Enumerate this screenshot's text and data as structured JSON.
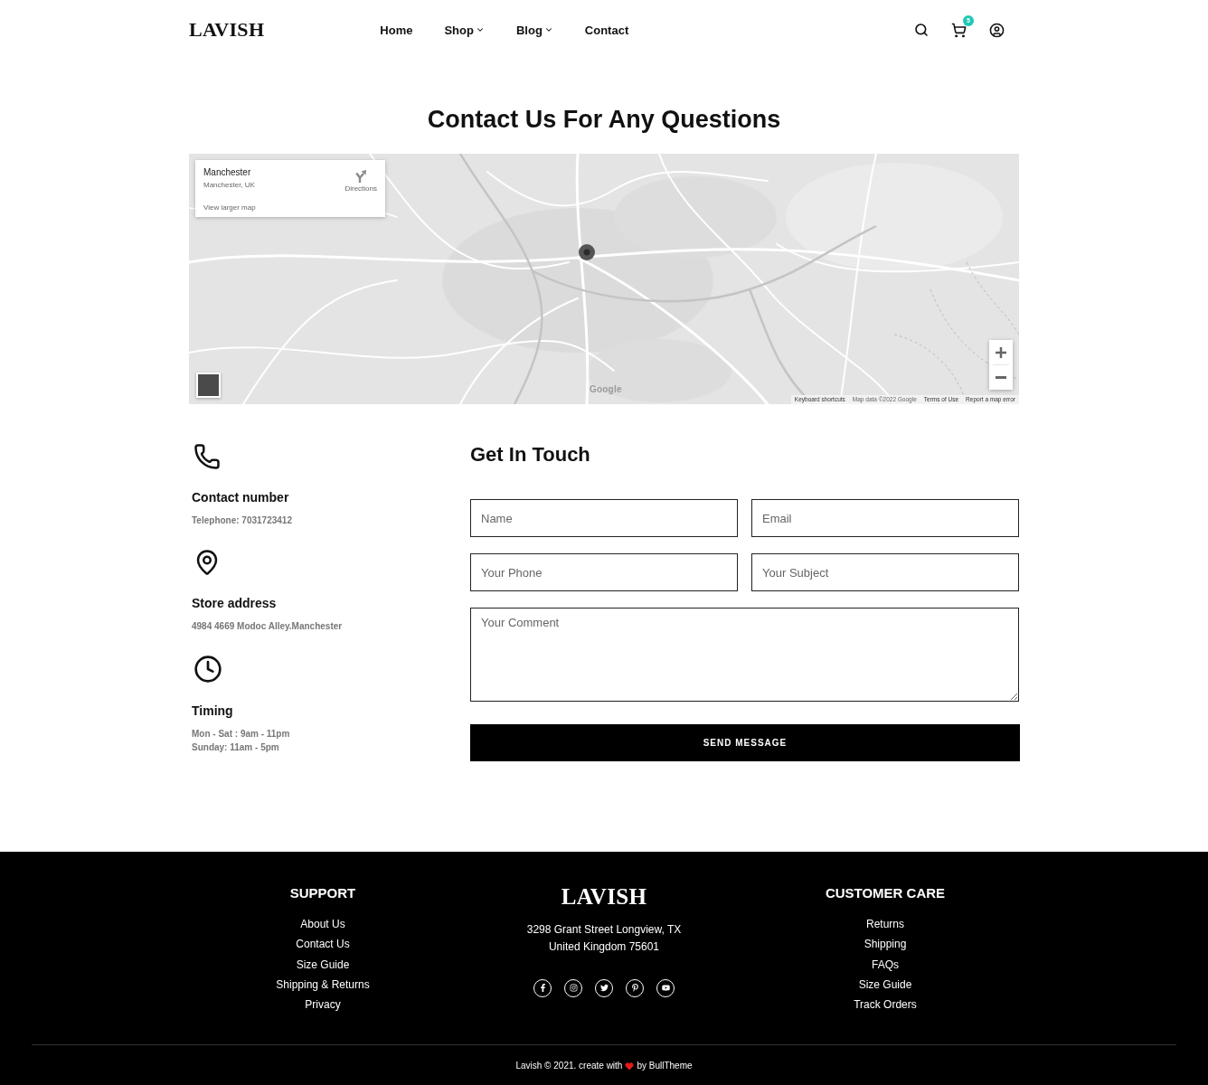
{
  "header": {
    "logo": "LAVISH",
    "nav": [
      {
        "label": "Home",
        "dropdown": false
      },
      {
        "label": "Shop",
        "dropdown": true
      },
      {
        "label": "Blog",
        "dropdown": true
      },
      {
        "label": "Contact",
        "dropdown": false
      }
    ],
    "cart_count": "5"
  },
  "page_title": "Contact Us For Any Questions",
  "map": {
    "place_card": {
      "title": "Manchester",
      "subtitle": "Manchester, UK",
      "directions": "Directions",
      "larger_map_link": "View larger map"
    },
    "logo": "Google",
    "attribution": [
      {
        "kind": "link",
        "text": "Keyboard shortcuts"
      },
      {
        "kind": "text",
        "text": "Map data ©2022 Google"
      },
      {
        "kind": "link",
        "text": "Terms of Use"
      },
      {
        "kind": "link",
        "text": "Report a map error"
      }
    ]
  },
  "contact_info": [
    {
      "kind": "phone",
      "heading": "Contact number",
      "lines": [
        "Telephone: 7031723412"
      ]
    },
    {
      "kind": "address",
      "heading": "Store address",
      "lines": [
        "4984 4669 Modoc Alley.Manchester"
      ]
    },
    {
      "kind": "hours",
      "heading": "Timing",
      "lines": [
        "Mon - Sat : 9am - 11pm",
        "Sunday: 11am - 5pm"
      ]
    }
  ],
  "form": {
    "title": "Get In Touch",
    "fields": [
      {
        "kind": "text",
        "placeholder": "Name"
      },
      {
        "kind": "text",
        "placeholder": "Email"
      },
      {
        "kind": "text",
        "placeholder": "Your Phone"
      },
      {
        "kind": "text",
        "placeholder": "Your Subject"
      },
      {
        "kind": "textarea",
        "placeholder": "Your Comment"
      }
    ],
    "submit": "SEND MESSAGE"
  },
  "footer": {
    "left_column": {
      "heading": "SUPPORT",
      "links": [
        "About Us",
        "Contact Us",
        "Size Guide",
        "Shipping & Returns",
        "Privacy"
      ]
    },
    "brand": {
      "logo": "LAVISH",
      "address": [
        "3298 Grant Street Longview, TX",
        "United Kingdom 75601"
      ],
      "social": [
        {
          "kind": "facebook"
        },
        {
          "kind": "instagram"
        },
        {
          "kind": "twitter"
        },
        {
          "kind": "pinterest"
        },
        {
          "kind": "youtube"
        }
      ]
    },
    "right_column": {
      "heading": "CUSTOMER CARE",
      "links": [
        "Returns",
        "Shipping",
        "FAQs",
        "Size Guide",
        "Track Orders"
      ]
    },
    "copyright": {
      "before": "Lavish © 2021. create with",
      "after": "by BullTheme"
    }
  }
}
